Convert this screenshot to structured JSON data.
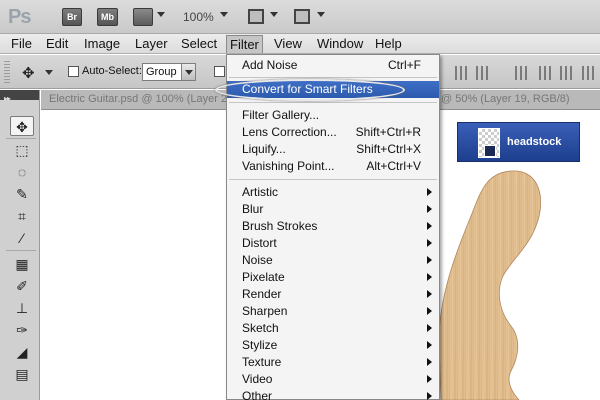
{
  "app": {
    "logo": "Ps",
    "bridge_label": "Br",
    "minibridge_label": "Mb",
    "zoom": "100%"
  },
  "menubar": {
    "items": [
      "File",
      "Edit",
      "Image",
      "Layer",
      "Select",
      "Filter",
      "View",
      "Window",
      "Help"
    ],
    "active": "Filter"
  },
  "options": {
    "auto_select_label": "Auto-Select:",
    "auto_select_checked": false,
    "auto_select_target": "Group"
  },
  "document": {
    "title": "Electric Guitar.psd @ 100% (Layer 2, RGB/8)",
    "title_right": "@ 50% (Layer 19, RGB/8)"
  },
  "layer_thumbnail": {
    "name": "headstock"
  },
  "filter_menu": {
    "last_filter": {
      "label": "Add Noise",
      "shortcut": "Ctrl+F"
    },
    "convert_smart": {
      "label": "Convert for Smart Filters"
    },
    "tools": [
      {
        "label": "Filter Gallery...",
        "shortcut": ""
      },
      {
        "label": "Lens Correction...",
        "shortcut": "Shift+Ctrl+R"
      },
      {
        "label": "Liquify...",
        "shortcut": "Shift+Ctrl+X"
      },
      {
        "label": "Vanishing Point...",
        "shortcut": "Alt+Ctrl+V"
      }
    ],
    "categories": [
      "Artistic",
      "Blur",
      "Brush Strokes",
      "Distort",
      "Noise",
      "Pixelate",
      "Render",
      "Sharpen",
      "Sketch",
      "Stylize",
      "Texture",
      "Video",
      "Other"
    ]
  },
  "colors": {
    "menu_highlight": "#2b5aae",
    "wood_light": "#e8c79c",
    "wood_dark": "#c89a63"
  }
}
